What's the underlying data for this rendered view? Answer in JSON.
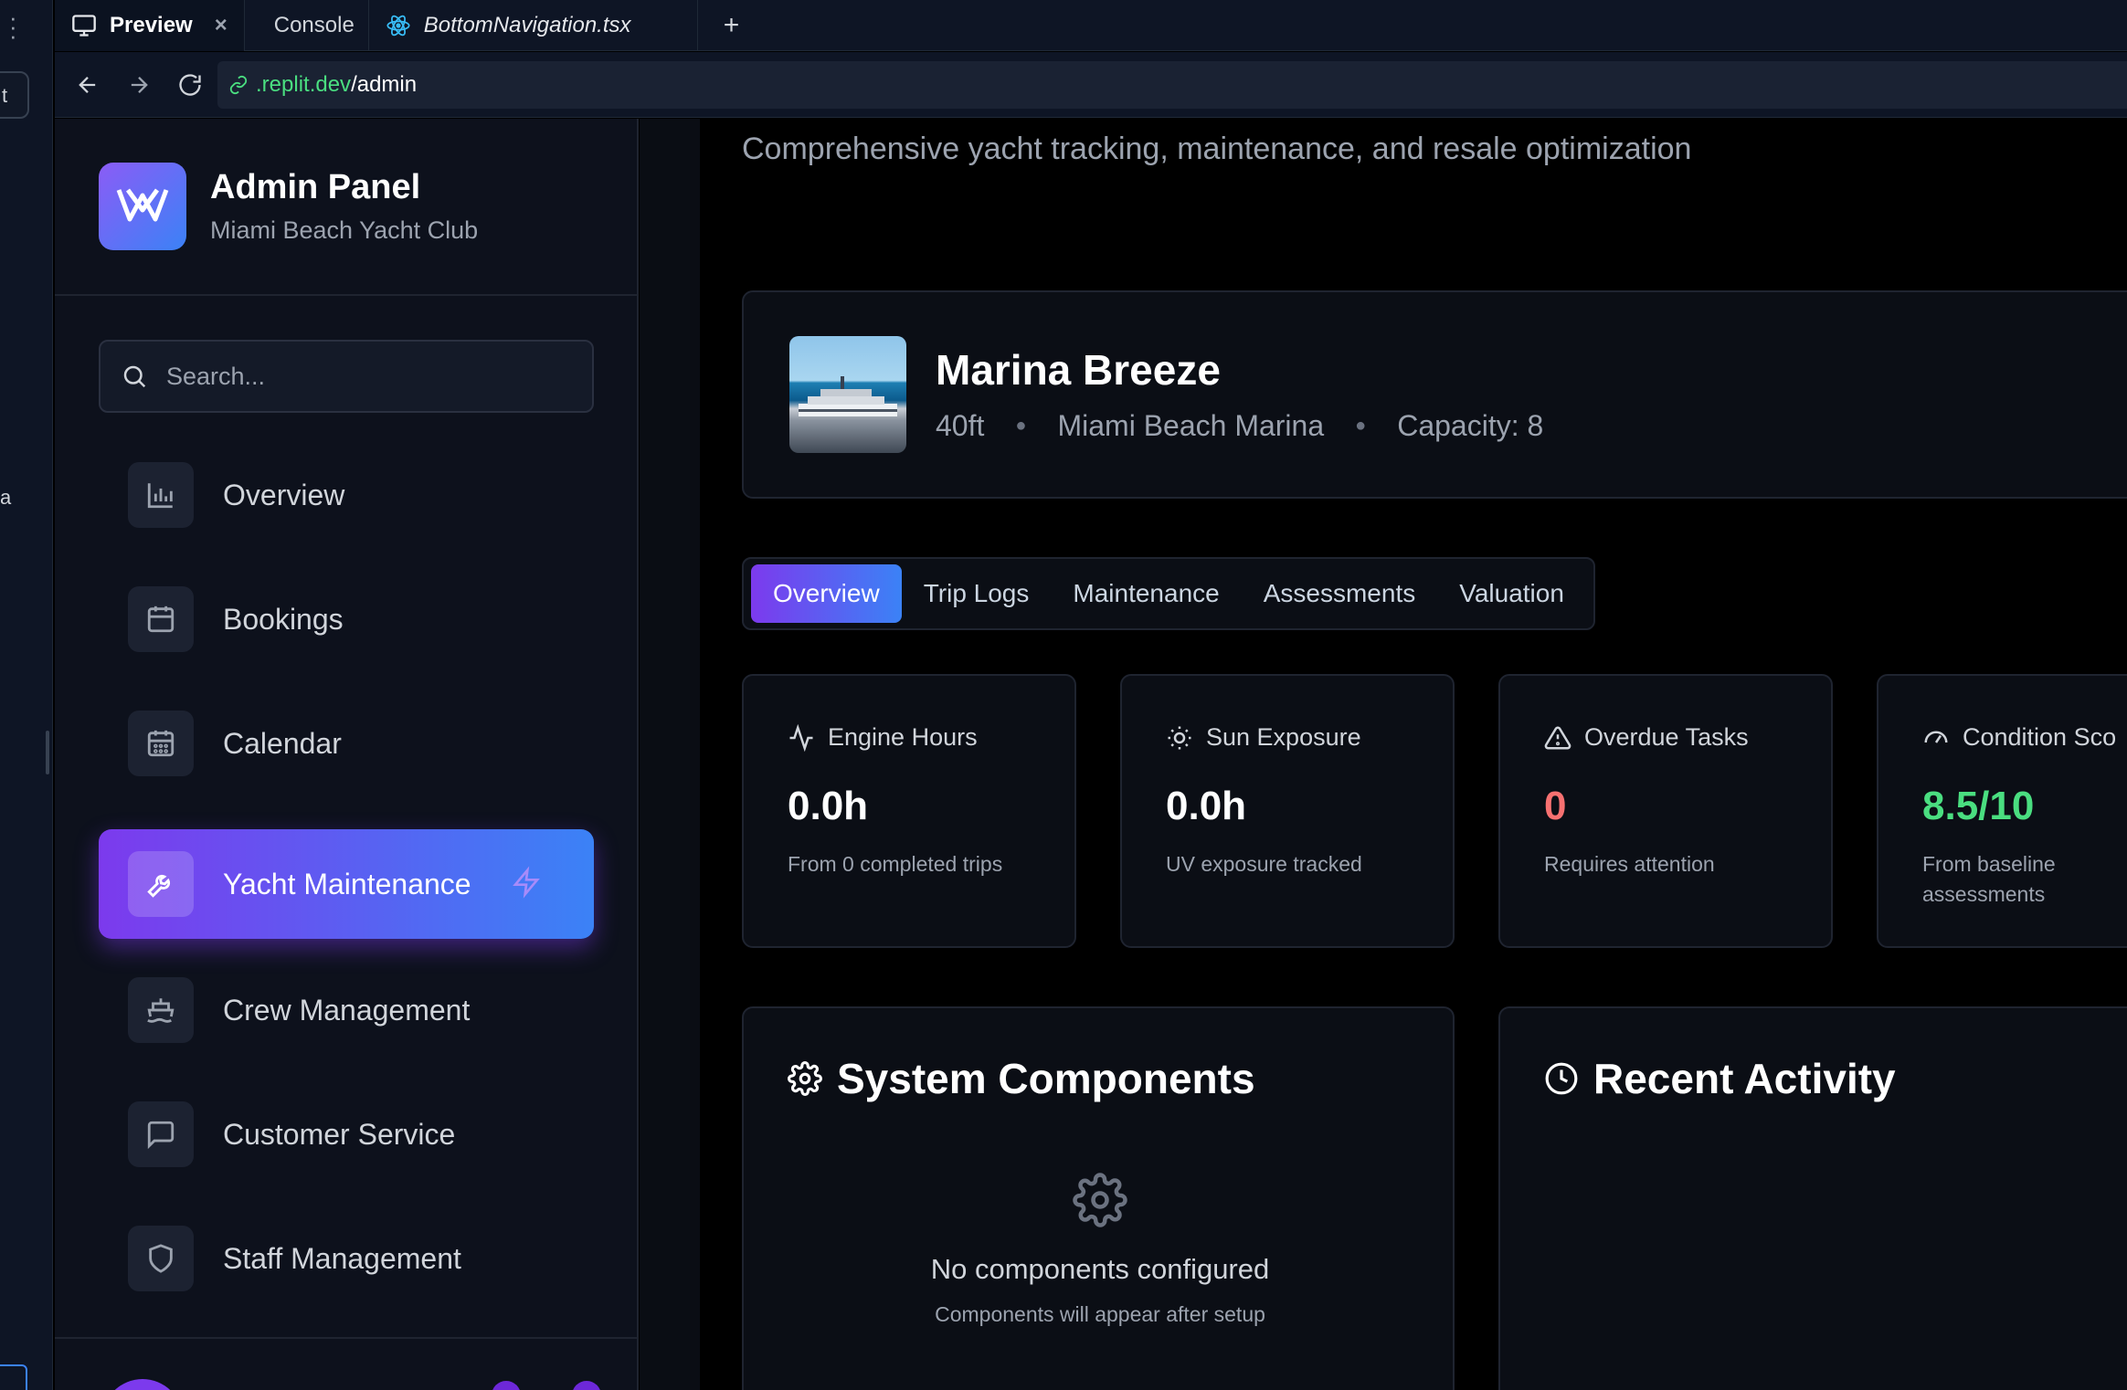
{
  "ide": {
    "tabs": [
      {
        "label": "Preview"
      },
      {
        "label": "Console"
      },
      {
        "label": "BottomNavigation.tsx"
      }
    ],
    "left_rail_fragments": [
      "t",
      "a"
    ],
    "url_domain": ".replit.dev",
    "url_path": "/admin"
  },
  "sidebar": {
    "title": "Admin Panel",
    "subtitle": "Miami Beach Yacht Club",
    "search_placeholder": "Search...",
    "items": [
      {
        "label": "Overview",
        "icon": "bar-chart-icon"
      },
      {
        "label": "Bookings",
        "icon": "calendar-icon"
      },
      {
        "label": "Calendar",
        "icon": "calendar-grid-icon"
      },
      {
        "label": "Yacht Maintenance",
        "icon": "wrench-icon",
        "active": true
      },
      {
        "label": "Crew Management",
        "icon": "ship-icon"
      },
      {
        "label": "Customer Service",
        "icon": "message-icon"
      },
      {
        "label": "Staff Management",
        "icon": "shield-icon"
      }
    ]
  },
  "main": {
    "subtitle": "Comprehensive yacht tracking, maintenance, and resale optimization",
    "yacht": {
      "name": "Marina Breeze",
      "length": "40ft",
      "location": "Miami Beach Marina",
      "capacity": "Capacity: 8"
    },
    "tabs": [
      "Overview",
      "Trip Logs",
      "Maintenance",
      "Assessments",
      "Valuation"
    ],
    "stats": [
      {
        "label": "Engine Hours",
        "value": "0.0h",
        "note": "From 0 completed trips",
        "icon": "activity-icon",
        "color": "#ffffff"
      },
      {
        "label": "Sun Exposure",
        "value": "0.0h",
        "note": "UV exposure tracked",
        "icon": "sun-icon",
        "color": "#ffffff"
      },
      {
        "label": "Overdue Tasks",
        "value": "0",
        "note": "Requires attention",
        "icon": "alert-triangle-icon",
        "color": "#f87171"
      },
      {
        "label": "Condition Sco",
        "value": "8.5/10",
        "note": "From baseline assessments",
        "icon": "gauge-icon",
        "color": "#4ade80"
      }
    ],
    "system_components": {
      "title": "System Components",
      "empty_title": "No components configured",
      "empty_sub": "Components will appear after setup"
    },
    "recent_activity": {
      "title": "Recent Activity"
    }
  },
  "colors": {
    "accent_start": "#7c3aed",
    "accent_end": "#3b82f6",
    "danger": "#f87171",
    "success": "#4ade80"
  }
}
